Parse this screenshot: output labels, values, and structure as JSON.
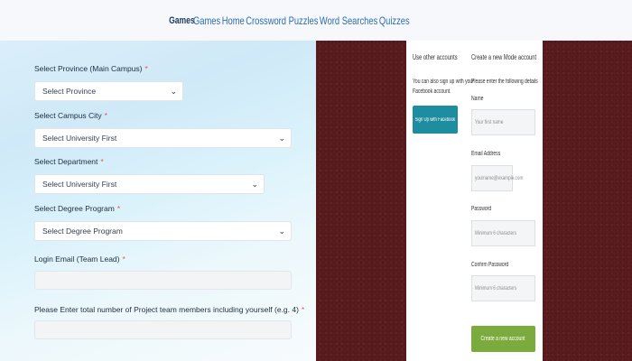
{
  "nav": {
    "brand": "Games",
    "links": [
      "Games",
      "Home",
      "Crossword Puzzles",
      "Word Searches",
      "Quizzes"
    ]
  },
  "form": {
    "province": {
      "label": "Select Province (Main Campus)",
      "value": "Select Province"
    },
    "campus_city": {
      "label": "Select Campus City",
      "value": "Select University First"
    },
    "department": {
      "label": "Select Department",
      "value": "Select University First"
    },
    "degree": {
      "label": "Select Degree Program",
      "value": "Select Degree Program"
    },
    "email": {
      "label": "Login Email (Team Lead)",
      "value": ""
    },
    "members": {
      "label": "Please Enter total number of Project team members including yourself (e.g. 4)",
      "value": ""
    },
    "required_mark": "*"
  },
  "signup": {
    "other_accounts_title": "Use other accounts",
    "other_accounts_desc": [
      "You can also sign up with your",
      "Facebook account."
    ],
    "facebook_button": "Sign Up with Facebook",
    "create_title": "Create a new Mode account",
    "create_desc": "Please enter the following details",
    "name_label": "Name",
    "name_placeholder": "Your first name",
    "email_label": "Email Address",
    "email_placeholder": "yourname@example.com",
    "password_label": "Password",
    "password_placeholder": "Minimum 6 characters",
    "confirm_label": "Confirm Password",
    "confirm_placeholder": "Minimum 6 characters",
    "create_button": "Create a new account"
  },
  "colors": {
    "maroon": "#5a1b1f",
    "facebook_button": "#1f8da0",
    "create_button": "#7aab3c",
    "required": "#e05a5a"
  }
}
